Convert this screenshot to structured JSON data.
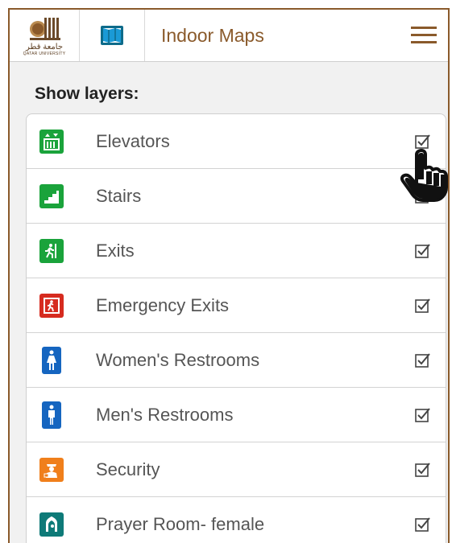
{
  "header": {
    "logo_arabic": "جامعة قطر",
    "logo_english": "QATAR UNIVERSITY",
    "title": "Indoor Maps"
  },
  "section_label": "Show layers:",
  "layers": [
    {
      "label": "Elevators",
      "icon": "elevator-icon",
      "color": "#1aa33b",
      "checked": true
    },
    {
      "label": "Stairs",
      "icon": "stairs-icon",
      "color": "#1aa33b",
      "checked": true
    },
    {
      "label": "Exits",
      "icon": "exit-icon",
      "color": "#1aa33b",
      "checked": true
    },
    {
      "label": "Emergency Exits",
      "icon": "emergency-exit-icon",
      "color": "#d62b1f",
      "checked": true
    },
    {
      "label": "Women's Restrooms",
      "icon": "women-restroom-icon",
      "color": "#1565c0",
      "checked": true
    },
    {
      "label": "Men's Restrooms",
      "icon": "men-restroom-icon",
      "color": "#1565c0",
      "checked": true
    },
    {
      "label": "Security",
      "icon": "security-icon",
      "color": "#f07f1b",
      "checked": true
    },
    {
      "label": "Prayer Room- female",
      "icon": "prayer-room-icon",
      "color": "#0e7a78",
      "checked": true
    }
  ],
  "colors": {
    "brand": "#8a5a2b",
    "green": "#1aa33b",
    "red": "#d62b1f",
    "blue": "#1565c0",
    "orange": "#f07f1b",
    "teal": "#0e7a78"
  }
}
